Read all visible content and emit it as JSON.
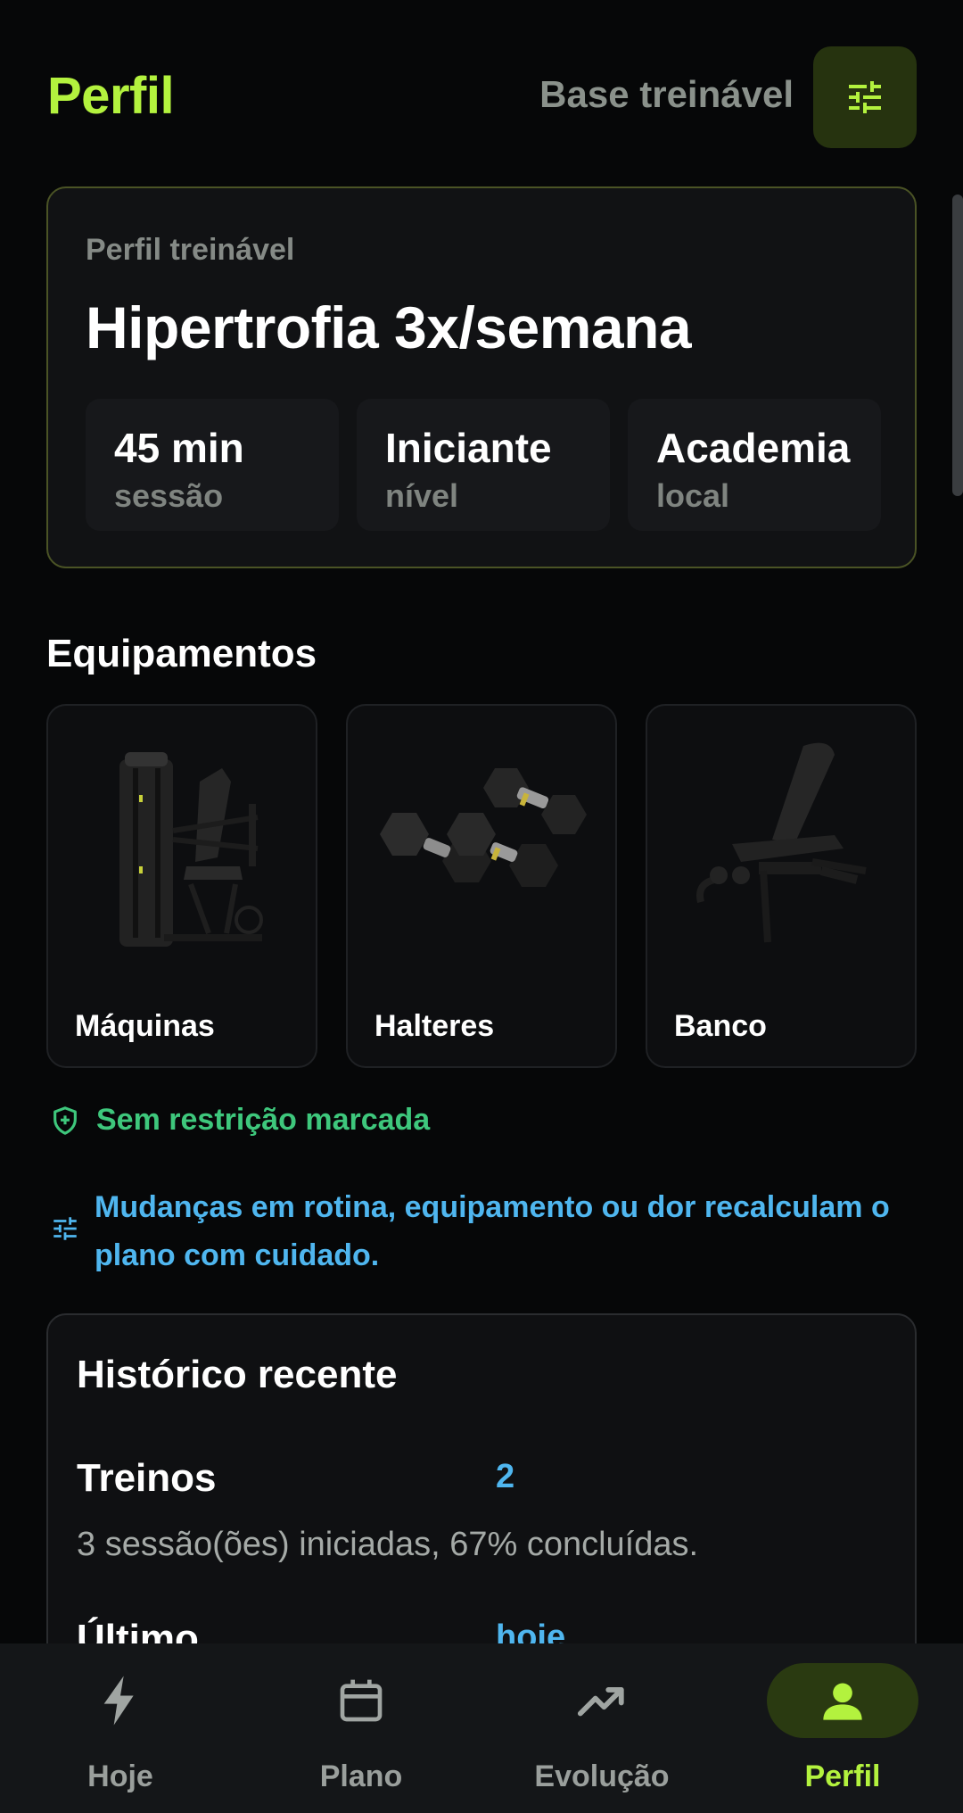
{
  "header": {
    "title": "Perfil",
    "subtitle": "Base treinável",
    "filter_icon": "tune-icon"
  },
  "profile": {
    "eyebrow": "Perfil treinável",
    "name": "Hipertrofia 3x/semana",
    "stats": [
      {
        "value": "45 min",
        "label": "sessão"
      },
      {
        "value": "Iniciante",
        "label": "nível"
      },
      {
        "value": "Academia",
        "label": "local"
      }
    ]
  },
  "equipment": {
    "title": "Equipamentos",
    "items": [
      {
        "name": "Máquinas",
        "image": "chest-press-machine"
      },
      {
        "name": "Halteres",
        "image": "dumbbells"
      },
      {
        "name": "Banco",
        "image": "adjustable-bench"
      }
    ]
  },
  "restriction": {
    "icon": "shield-plus-icon",
    "text": "Sem restrição marcada"
  },
  "notice": {
    "icon": "tune-icon",
    "text": "Mudanças em rotina, equipamento ou dor recalculam o plano com cuidado."
  },
  "history": {
    "title": "Histórico recente",
    "rows": [
      {
        "label": "Treinos",
        "value": "2",
        "desc": "3 sessão(ões) iniciadas, 67% concluídas."
      },
      {
        "label": "Último",
        "value": "hoje"
      }
    ]
  },
  "nav": {
    "items": [
      {
        "label": "Hoje",
        "icon": "bolt-icon",
        "active": false
      },
      {
        "label": "Plano",
        "icon": "calendar-icon",
        "active": false
      },
      {
        "label": "Evolução",
        "icon": "trending-up-icon",
        "active": false
      },
      {
        "label": "Perfil",
        "icon": "person-icon",
        "active": true
      }
    ]
  },
  "colors": {
    "accent": "#b3f23e",
    "success": "#3ec77c",
    "info": "#4fb6ef",
    "background": "#060708"
  }
}
